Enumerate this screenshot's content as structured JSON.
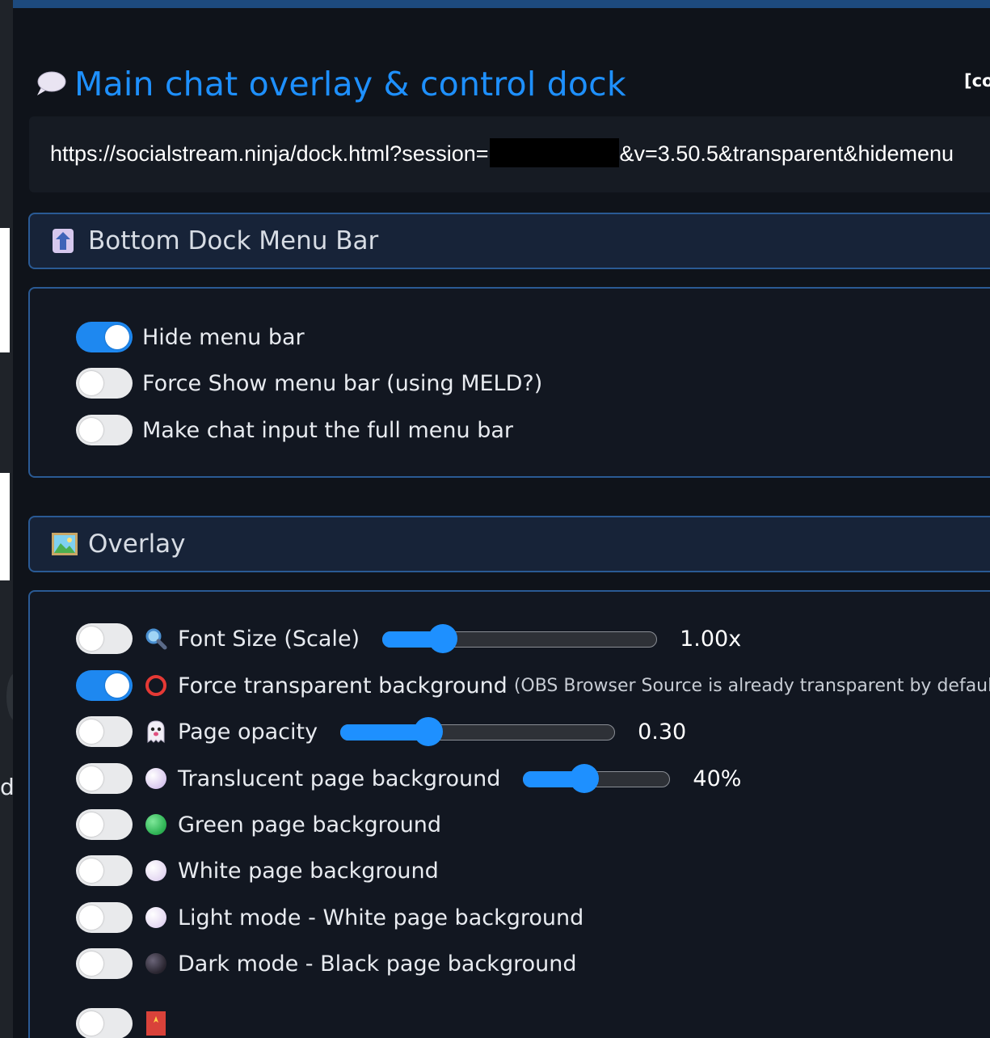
{
  "header": {
    "title": "Main chat overlay & control dock",
    "corner_text": "[co",
    "title_icon": "speech-bubble-icon"
  },
  "url_box": {
    "url_prefix": "https://socialstream.ninja/dock.html?session=",
    "url_suffix": "&v=3.50.5&transparent&hidemenu"
  },
  "left_strip": {
    "letter": "d"
  },
  "sections": {
    "bottom_dock": {
      "title": "Bottom Dock Menu Bar",
      "icon": "up-arrow-icon",
      "options": [
        {
          "label": "Hide menu bar",
          "enabled": true
        },
        {
          "label": "Force Show menu bar (using MELD?)",
          "enabled": false
        },
        {
          "label": "Make chat input the full menu bar",
          "enabled": false
        }
      ]
    },
    "overlay": {
      "title": "Overlay",
      "icon": "framed-picture-icon",
      "options": [
        {
          "label": "Font Size (Scale)",
          "enabled": false,
          "icon": "magnifier-icon",
          "slider_value": "1.00x",
          "slider_fraction": 0.22
        },
        {
          "label": "Force transparent background",
          "note": "(OBS Browser Source is already transparent by default)",
          "enabled": true,
          "icon": "hollow-red-circle-icon"
        },
        {
          "label": "Page opacity",
          "enabled": false,
          "icon": "ghost-icon",
          "slider_value": "0.30",
          "slider_fraction": 0.32
        },
        {
          "label": "Translucent page background",
          "enabled": false,
          "icon": "light-purple-circle-icon",
          "slider_value": "40%",
          "slider_fraction": 0.42
        },
        {
          "label": "Green page background",
          "enabled": false,
          "icon": "green-circle-icon"
        },
        {
          "label": "White page background",
          "enabled": false,
          "icon": "white-circle-icon"
        },
        {
          "label": "Light mode - White page background",
          "enabled": false,
          "icon": "white-circle-icon"
        },
        {
          "label": "Dark mode - Black page background",
          "enabled": false,
          "icon": "black-circle-icon"
        },
        {
          "label": "",
          "enabled": false,
          "icon": "firework-icon"
        }
      ]
    }
  },
  "colors": {
    "accent": "#1e90ff",
    "section_border": "#2a5a94",
    "background": "#0f131a"
  }
}
